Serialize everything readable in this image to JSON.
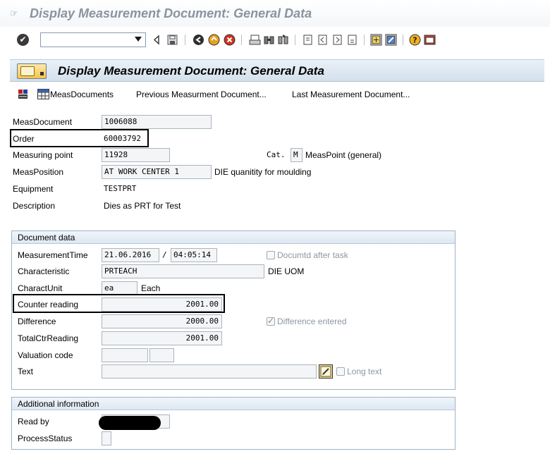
{
  "window": {
    "title": "Display Measurement Document: General Data"
  },
  "toolbar": {
    "command_field_value": ""
  },
  "header": {
    "title": "Display Measurement Document: General Data"
  },
  "app_toolbar": {
    "meas_documents": "MeasDocuments",
    "previous": "Previous Measurment Document...",
    "last": "Last Measurement Document..."
  },
  "general": {
    "meas_document_label": "MeasDocument",
    "meas_document_value": "1006088",
    "order_label": "Order",
    "order_value": "60003792",
    "measuring_point_label": "Measuring point",
    "measuring_point_value": "11928",
    "cat_label": "Cat.",
    "cat_value": "M",
    "cat_desc": "MeasPoint (general)",
    "meas_position_label": "MeasPosition",
    "meas_position_value": "AT WORK CENTER 1",
    "meas_position_desc": "DIE quanitity for moulding",
    "equipment_label": "Equipment",
    "equipment_value": "TESTPRT",
    "description_label": "Description",
    "description_value": "Dies as PRT for Test"
  },
  "document_data": {
    "title": "Document data",
    "measurement_time_label": "MeasurementTime",
    "date_value": "21.06.2016",
    "date_sep": "/",
    "time_value": "04:05:14",
    "documented_after_task_label": "Documtd after task",
    "documented_after_task_checked": false,
    "characteristic_label": "Characteristic",
    "characteristic_value": "PRTEACH",
    "characteristic_desc": "DIE UOM",
    "charact_unit_label": "CharactUnit",
    "charact_unit_value": "ea",
    "charact_unit_desc": "Each",
    "counter_reading_label": "Counter reading",
    "counter_reading_value": "2001.00",
    "difference_label": "Difference",
    "difference_value": "2000.00",
    "difference_entered_label": "Difference entered",
    "difference_entered_checked": true,
    "total_ctr_reading_label": "TotalCtrReading",
    "total_ctr_reading_value": "2001.00",
    "valuation_code_label": "Valuation code",
    "valuation_code_value": "",
    "valuation_code_value2": "",
    "text_label": "Text",
    "text_value": "",
    "long_text_label": "Long text",
    "long_text_checked": false
  },
  "additional_info": {
    "title": "Additional information",
    "read_by_label": "Read by",
    "process_status_label": "ProcessStatus",
    "process_status_value": ""
  },
  "colors": {
    "header_bg": "#d3e0ec",
    "group_border": "#9fb3c5",
    "field_bg": "#f4f5f7",
    "disabled_text": "#8c97a1"
  }
}
